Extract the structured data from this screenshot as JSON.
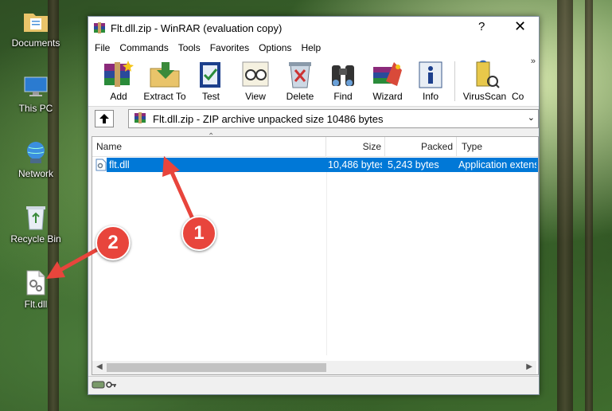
{
  "desktop": {
    "icons": [
      {
        "label": "Documents",
        "icon": "folder-documents-icon"
      },
      {
        "label": "This PC",
        "icon": "computer-icon"
      },
      {
        "label": "Network",
        "icon": "network-globe-icon"
      },
      {
        "label": "Recycle Bin",
        "icon": "recycle-bin-icon"
      },
      {
        "label": "Flt.dll",
        "icon": "dll-file-icon"
      }
    ]
  },
  "window": {
    "title": "Flt.dll.zip - WinRAR (evaluation copy)",
    "help_label": "?",
    "close_label": "✕"
  },
  "menu": [
    "File",
    "Commands",
    "Tools",
    "Favorites",
    "Options",
    "Help"
  ],
  "toolbar": {
    "buttons": [
      {
        "label": "Add",
        "icon": "add-archive-icon"
      },
      {
        "label": "Extract To",
        "icon": "extract-folder-icon"
      },
      {
        "label": "Test",
        "icon": "test-archive-icon"
      },
      {
        "label": "View",
        "icon": "view-glasses-icon"
      },
      {
        "label": "Delete",
        "icon": "delete-icon"
      },
      {
        "label": "Find",
        "icon": "find-binoculars-icon"
      },
      {
        "label": "Wizard",
        "icon": "wizard-icon"
      },
      {
        "label": "Info",
        "icon": "info-icon"
      },
      {
        "label": "VirusScan",
        "icon": "virusscan-icon"
      },
      {
        "label": "Co",
        "icon": "comment-icon"
      }
    ],
    "overflow": "»"
  },
  "address": {
    "text": "Flt.dll.zip - ZIP archive unpacked size 10486 bytes"
  },
  "columns": {
    "name": "Name",
    "size": "Size",
    "packed": "Packed",
    "type": "Type"
  },
  "files": [
    {
      "name": "flt.dll",
      "size": "10,486 bytes",
      "packed": "5,243 bytes",
      "type": "Application extension"
    }
  ],
  "annotations": {
    "badge1": "1",
    "badge2": "2"
  },
  "colors": {
    "selection": "#0078d7",
    "badge": "#e8453c"
  }
}
